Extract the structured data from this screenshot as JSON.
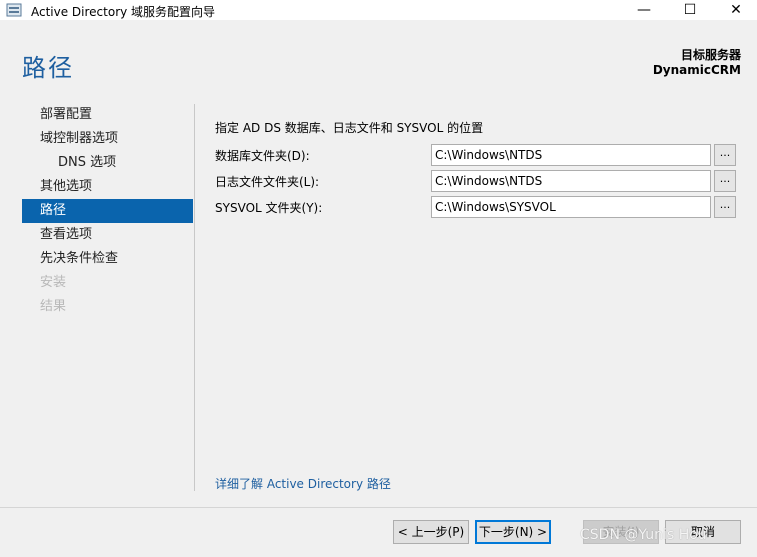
{
  "window": {
    "title": "Active Directory 域服务配置向导",
    "minimize_glyph": "—",
    "maximize_glyph": "☐",
    "close_glyph": "✕",
    "app_icon": "server-icon"
  },
  "header": {
    "page_title": "路径",
    "target_label": "目标服务器",
    "target_value": "DynamicCRM"
  },
  "nav": {
    "items": [
      {
        "label": "部署配置",
        "state": "normal"
      },
      {
        "label": "域控制器选项",
        "state": "normal"
      },
      {
        "label": "DNS 选项",
        "state": "indent"
      },
      {
        "label": "其他选项",
        "state": "normal"
      },
      {
        "label": "路径",
        "state": "active"
      },
      {
        "label": "查看选项",
        "state": "normal"
      },
      {
        "label": "先决条件检查",
        "state": "normal"
      },
      {
        "label": "安装",
        "state": "disabled"
      },
      {
        "label": "结果",
        "state": "disabled"
      }
    ]
  },
  "main": {
    "intro": "指定 AD DS 数据库、日志文件和 SYSVOL 的位置",
    "fields": [
      {
        "label": "数据库文件夹(D):",
        "value": "C:\\Windows\\NTDS",
        "browse": "..."
      },
      {
        "label": "日志文件文件夹(L):",
        "value": "C:\\Windows\\NTDS",
        "browse": "..."
      },
      {
        "label": "SYSVOL 文件夹(Y):",
        "value": "C:\\Windows\\SYSVOL",
        "browse": "..."
      }
    ],
    "learn_more": "详细了解 Active Directory 路径"
  },
  "footer": {
    "prev": "< 上一步(P)",
    "next": "下一步(N) >",
    "install": "安装(I)",
    "cancel": "取消"
  },
  "watermark": "CSDN @Yunis Hou",
  "colors": {
    "accent": "#0a64ad",
    "title_blue": "#1e5fa0"
  }
}
